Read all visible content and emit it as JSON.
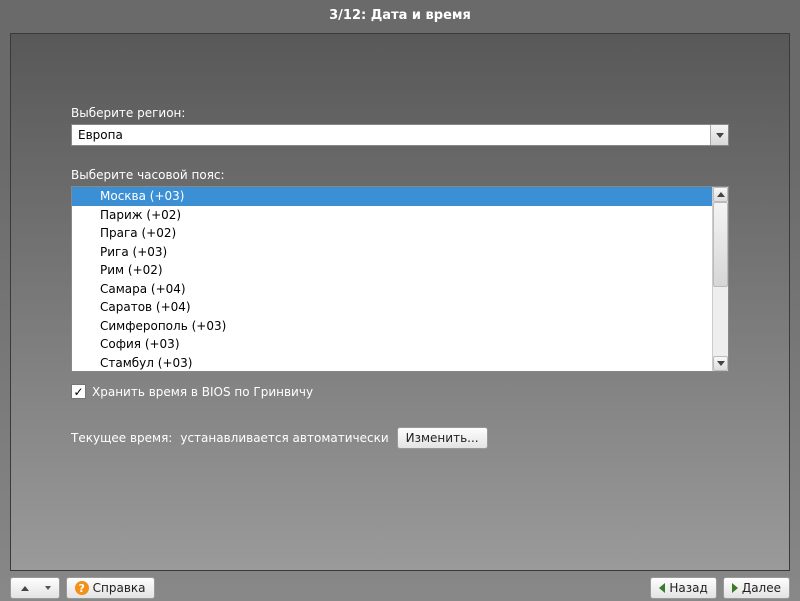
{
  "header": {
    "title": "3/12: Дата и время"
  },
  "region": {
    "label": "Выберите регион:",
    "value": "Европа"
  },
  "timezone": {
    "label": "Выберите часовой пояс:",
    "items": [
      "Москва (+03)",
      "Париж (+02)",
      "Прага (+02)",
      "Рига (+03)",
      "Рим (+02)",
      "Самара (+04)",
      "Саратов (+04)",
      "Симферополь (+03)",
      "София (+03)",
      "Стамбул (+03)"
    ],
    "selected_index": 0
  },
  "bios_checkbox": {
    "checked": true,
    "label": "Хранить время в BIOS по Гринвичу"
  },
  "current_time": {
    "label": "Текущее время:",
    "value": "устанавливается автоматически",
    "change_btn": "Изменить..."
  },
  "footer": {
    "help": "Справка",
    "back": "Назад",
    "next": "Далее"
  }
}
